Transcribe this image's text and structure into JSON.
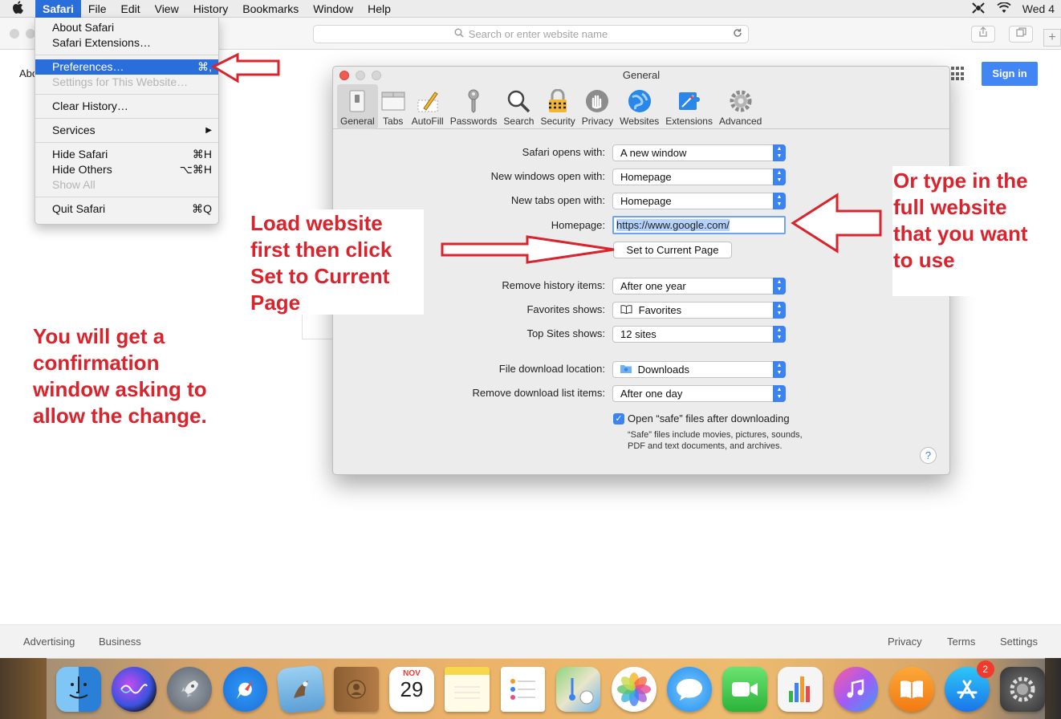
{
  "menubar": {
    "app_menu": "Safari",
    "items": [
      "File",
      "Edit",
      "View",
      "History",
      "Bookmarks",
      "Window",
      "Help"
    ],
    "clock": "Wed 4"
  },
  "toolbar": {
    "address_placeholder": "Search or enter website name"
  },
  "page": {
    "about_text": "Abo",
    "signin_label": "Sign in",
    "footer_left": [
      "Advertising",
      "Business"
    ],
    "footer_right": [
      "Privacy",
      "Terms",
      "Settings"
    ]
  },
  "safari_menu": {
    "about": "About Safari",
    "extensions": "Safari Extensions…",
    "preferences": "Preferences…",
    "preferences_shortcut": "⌘,",
    "settings_site": "Settings for This Website…",
    "clear_history": "Clear History…",
    "services": "Services",
    "services_arrow": "▶",
    "hide_safari": "Hide Safari",
    "hide_safari_shortcut": "⌘H",
    "hide_others": "Hide Others",
    "hide_others_shortcut": "⌥⌘H",
    "show_all": "Show All",
    "quit": "Quit Safari",
    "quit_shortcut": "⌘Q"
  },
  "prefs": {
    "title": "General",
    "tabs": [
      "General",
      "Tabs",
      "AutoFill",
      "Passwords",
      "Search",
      "Security",
      "Privacy",
      "Websites",
      "Extensions",
      "Advanced"
    ],
    "safari_opens_label": "Safari opens with:",
    "safari_opens_value": "A new window",
    "new_windows_label": "New windows open with:",
    "new_windows_value": "Homepage",
    "new_tabs_label": "New tabs open with:",
    "new_tabs_value": "Homepage",
    "homepage_label": "Homepage:",
    "homepage_value": "https://www.google.com/",
    "set_current_label": "Set to Current Page",
    "remove_history_label": "Remove history items:",
    "remove_history_value": "After one year",
    "favorites_label": "Favorites shows:",
    "favorites_value": "Favorites",
    "topsites_label": "Top Sites shows:",
    "topsites_value": "12 sites",
    "download_location_label": "File download location:",
    "download_location_value": "Downloads",
    "remove_download_label": "Remove download list items:",
    "remove_download_value": "After one day",
    "open_safe_label": "Open “safe” files after downloading",
    "open_safe_note": "“Safe” files include movies, pictures, sounds, PDF and text documents, and archives.",
    "help": "?"
  },
  "annotations": {
    "load_website": [
      "Load website",
      "first then click",
      "Set to Current",
      "Page"
    ],
    "type_website": [
      "Or type in the",
      "full website",
      "that you want",
      "to use"
    ],
    "confirmation": [
      "You will get a",
      "confirmation",
      "window asking to",
      "allow the change."
    ]
  },
  "dock": {
    "calendar_month": "NOV",
    "calendar_day": "29",
    "appstore_badge": "2",
    "icons": [
      "finder-icon",
      "siri-icon",
      "launchpad-icon",
      "safari-icon",
      "mail-icon",
      "contacts-icon",
      "calendar-icon",
      "notes-icon",
      "reminders-icon",
      "maps-icon",
      "photos-icon",
      "messages-icon",
      "facetime-icon",
      "numbers-icon",
      "itunes-icon",
      "ibooks-icon",
      "appstore-icon",
      "system-preferences-icon"
    ]
  },
  "colors": {
    "accent": "#2a6edb",
    "annotation_red": "#d9232d",
    "google_blue": "#4285f4"
  }
}
